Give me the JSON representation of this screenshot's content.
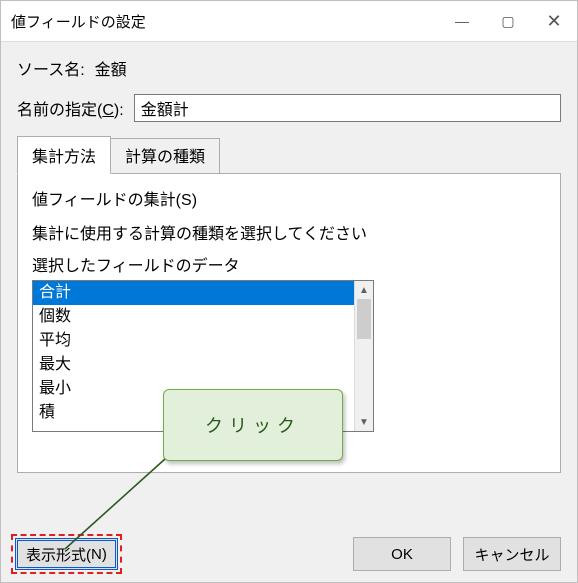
{
  "title": "値フィールドの設定",
  "window_buttons": {
    "minimize": "—",
    "maximize": "▢",
    "close": "✕"
  },
  "source": {
    "label": "ソース名:",
    "value": "金額"
  },
  "custom_name": {
    "label_pre": "名前の指定(",
    "label_u": "C",
    "label_post": "):",
    "value": "金額計"
  },
  "tabs": [
    {
      "label": "集計方法",
      "active": true
    },
    {
      "label": "計算の種類",
      "active": false
    }
  ],
  "panel": {
    "summarize_label_pre": "値フィールドの集計(",
    "summarize_label_u": "S",
    "summarize_label_post": ")",
    "instruction": "集計に使用する計算の種類を選択してください",
    "field_data_label": "選択したフィールドのデータ",
    "items": [
      "合計",
      "個数",
      "平均",
      "最大",
      "最小",
      "積"
    ],
    "selected_index": 0
  },
  "buttons": {
    "format_pre": "表示形式(",
    "format_u": "N",
    "format_post": ")",
    "ok": "OK",
    "cancel": "キャンセル"
  },
  "callout": "クリック",
  "scroll_arrows": {
    "up": "▲",
    "down": "▼"
  }
}
